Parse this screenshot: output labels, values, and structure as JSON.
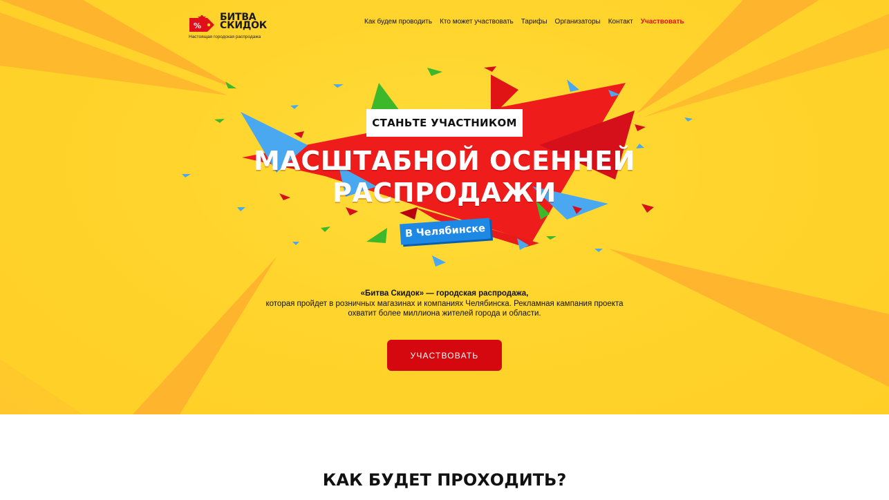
{
  "brand": {
    "name_line1": "БИТВА",
    "name_line2": "СКИДОК",
    "tagline": "Настоящая городская распродажа",
    "tag_symbol": "%"
  },
  "nav": {
    "items": [
      {
        "label": "Как будем проводить"
      },
      {
        "label": "Кто может участвовать"
      },
      {
        "label": "Тарифы"
      },
      {
        "label": "Организаторы"
      },
      {
        "label": "Контакт"
      },
      {
        "label": "Участвовать"
      }
    ]
  },
  "hero": {
    "badge": "СТАНЬТЕ УЧАСТНИКОМ",
    "headline_line1": "МАСШТАБНОЙ ОСЕННЕЙ",
    "headline_line2": "РАСПРОДАЖИ",
    "city": "В Челябинске",
    "desc_bold": "«Битва Скидок» — городская распродажа,",
    "desc_line2": "которая пройдет в розничных магазинах и компаниях Челябинска. Рекламная кампания проекта",
    "desc_line3": "охватит более миллиона жителей города и области.",
    "cta": "УЧАСТВОВАТЬ"
  },
  "section": {
    "title": "КАК БУДЕТ ПРОХОДИТЬ?"
  },
  "colors": {
    "background_yellow": "#ffd42c",
    "ray_orange": "#ffab2e",
    "accent_red": "#e0101a",
    "cta_red": "#d4080e",
    "blue": "#1e88e5",
    "green": "#3cb82a"
  }
}
